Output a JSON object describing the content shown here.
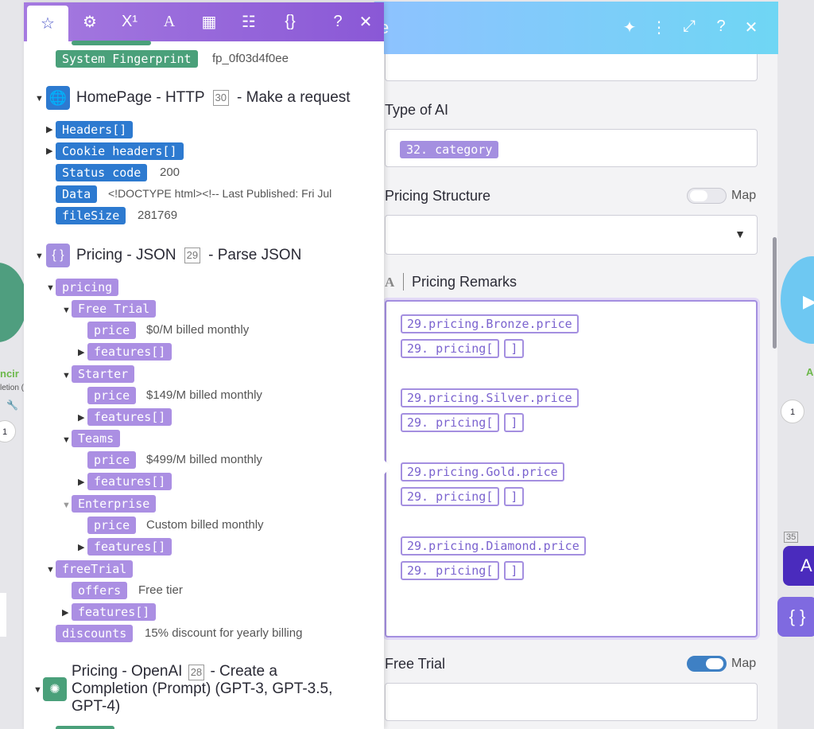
{
  "editor": {
    "header_title_fragment": "e",
    "type_of_ai_label": "Type of AI",
    "type_of_ai_tag": "32. category",
    "pricing_structure_label": "Pricing Structure",
    "map_label": "Map",
    "pricing_remarks_label": "Pricing Remarks",
    "pricing_remarks_icon": "A",
    "remarks_lines": [
      [
        "29.pricing.Bronze.price"
      ],
      [
        "29. pricing[",
        "]"
      ],
      [],
      [
        "29.pricing.Silver.price"
      ],
      [
        "29. pricing[",
        "]"
      ],
      [],
      [
        "29.pricing.Gold.price"
      ],
      [
        "29. pricing[",
        "]"
      ],
      [],
      [
        "29.pricing.Diamond.price"
      ],
      [
        "29. pricing[",
        "]"
      ]
    ],
    "free_trial_label": "Free Trial",
    "free_trial_map_on": true
  },
  "mapper": {
    "system_fingerprint_label": "System Fingerprint",
    "system_fingerprint_value": "fp_0f03d4f0ee",
    "http_title": "HomePage - HTTP",
    "http_num": "30",
    "http_action": "- Make a request",
    "headers_label": "Headers[]",
    "cookie_label": "Cookie headers[]",
    "status_label": "Status code",
    "status_value": "200",
    "data_label": "Data",
    "data_value": "<!DOCTYPE html><!-- Last Published: Fri Jul",
    "filesize_label": "fileSize",
    "filesize_value": "281769",
    "json_title": "Pricing - JSON",
    "json_num": "29",
    "json_action": "- Parse JSON",
    "pricing_label": "pricing",
    "tiers": [
      {
        "name": "Free Trial",
        "price": "$0/M billed monthly"
      },
      {
        "name": "Starter",
        "price": "$149/M billed monthly"
      },
      {
        "name": "Teams",
        "price": "$499/M billed monthly"
      },
      {
        "name": "Enterprise",
        "price": "Custom billed monthly"
      }
    ],
    "price_label": "price",
    "features_label": "features[]",
    "freetrial_label": "freeTrial",
    "offers_label": "offers",
    "offers_value": "Free tier",
    "discounts_label": "discounts",
    "discounts_value": "15% discount for yearly billing",
    "openai_title_1": "Pricing - OpenAI",
    "openai_num": "28",
    "openai_title_1b": "- Create a",
    "openai_title_2": "Completion (Prompt) (GPT-3, GPT-3.5,",
    "openai_title_3": "GPT-4)"
  },
  "canvas": {
    "left_node_label": "ncir",
    "left_node_sub": "letion (I",
    "left_badge": "1",
    "right_badge": "1",
    "right_num": "35",
    "right_letter": "A",
    "right_node_label": "A"
  },
  "colors": {
    "toolbar": "#8a58d6",
    "header": "#6fd6f4",
    "blue_pill": "#2d7ad0",
    "purple_pill": "#ab8fe3",
    "green_pill": "#4aa07a"
  }
}
